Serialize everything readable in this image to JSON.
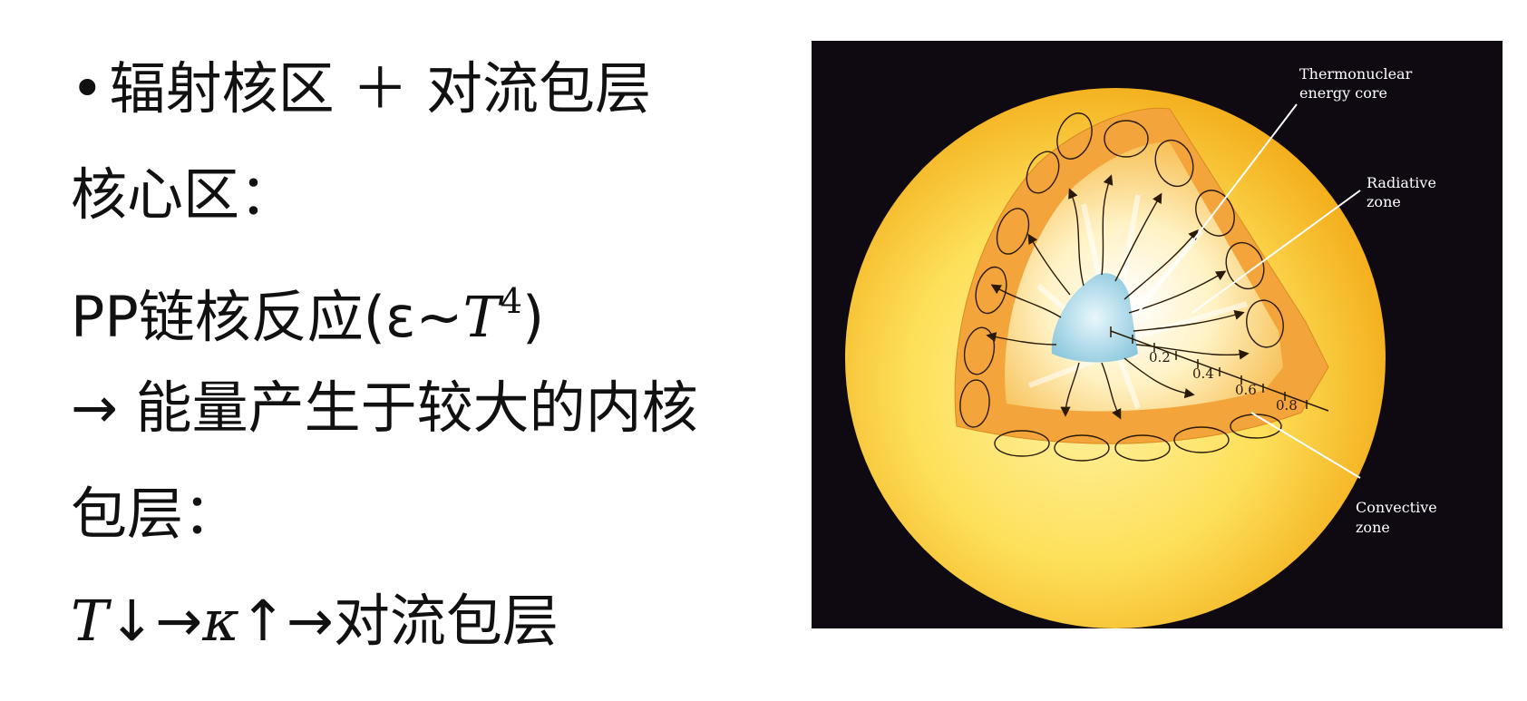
{
  "text_lines": {
    "line1_bullet": "•",
    "line1": "辐射核区 ＋ 对流包层",
    "line2": "核心区：",
    "line3_prefix": "PP链核反应(ε~",
    "line3_T": "T",
    "line3_exp": "4",
    "line3_suffix": ")",
    "line4": "→ 能量产生于较大的内核",
    "line5": "包层：",
    "line6_T": "T",
    "line6_mid": "↓→",
    "line6_kappa": "κ",
    "line6_end": "↑→对流包层"
  },
  "figure": {
    "labels": {
      "core_1": "Thermonuclear",
      "core_2": "energy core",
      "radiative_1": "Radiative",
      "radiative_2": "zone",
      "convective_1": "Convective",
      "convective_2": "zone"
    },
    "scale_ticks": [
      "0.2",
      "0.4",
      "0.6",
      "0.8"
    ],
    "colors": {
      "background": "#0f0a12",
      "sun_outer": "#f6b81c",
      "sun_inner": "#fde873",
      "core": "#9fd4e6",
      "convective": "#f0a43a"
    }
  }
}
